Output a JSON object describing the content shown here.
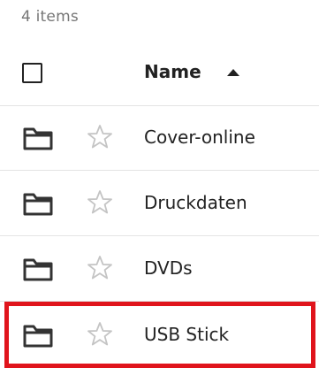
{
  "list": {
    "items_count": "4 items",
    "header": {
      "name_label": "Name",
      "sort_icon": "caret-up-icon"
    },
    "rows": [
      {
        "name": "Cover-online",
        "icon": "folder-icon",
        "favorite_icon": "star-outline-icon"
      },
      {
        "name": "Druckdaten",
        "icon": "folder-icon",
        "favorite_icon": "star-outline-icon"
      },
      {
        "name": "DVDs",
        "icon": "folder-icon",
        "favorite_icon": "star-outline-icon"
      },
      {
        "name": "USB Stick",
        "icon": "folder-icon",
        "favorite_icon": "star-outline-icon"
      }
    ],
    "highlight_color": "#e0141c"
  }
}
